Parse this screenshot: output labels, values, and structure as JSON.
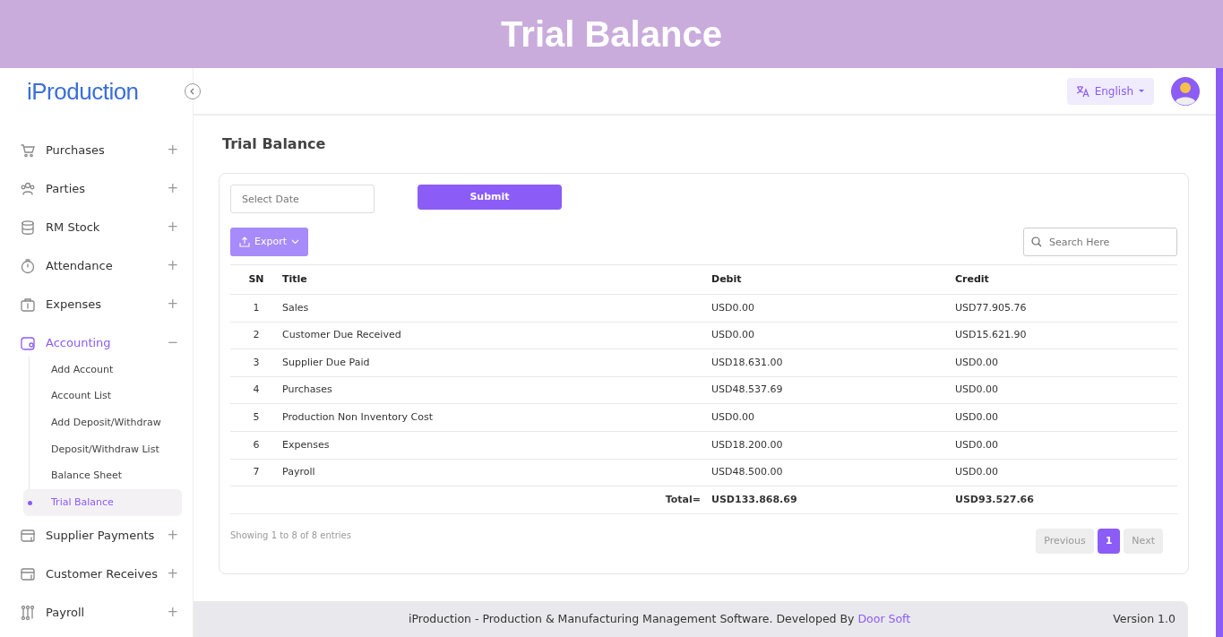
{
  "banner": {
    "title": "Trial Balance"
  },
  "sidebar": {
    "logo": "iProduction",
    "items": [
      {
        "label": "Purchases",
        "toggle": "+",
        "expanded": false
      },
      {
        "label": "Parties",
        "toggle": "+",
        "expanded": false
      },
      {
        "label": "RM Stock",
        "toggle": "+",
        "expanded": false
      },
      {
        "label": "Attendance",
        "toggle": "+",
        "expanded": false
      },
      {
        "label": "Expenses",
        "toggle": "+",
        "expanded": false
      },
      {
        "label": "Accounting",
        "toggle": "−",
        "expanded": true,
        "children": [
          {
            "label": "Add Account",
            "selected": false
          },
          {
            "label": "Account List",
            "selected": false
          },
          {
            "label": "Add Deposit/Withdraw",
            "selected": false
          },
          {
            "label": "Deposit/Withdraw List",
            "selected": false
          },
          {
            "label": "Balance Sheet",
            "selected": false
          },
          {
            "label": "Trial Balance",
            "selected": true
          }
        ]
      },
      {
        "label": "Supplier Payments",
        "toggle": "+",
        "expanded": false
      },
      {
        "label": "Customer Receives",
        "toggle": "+",
        "expanded": false
      },
      {
        "label": "Payroll",
        "toggle": "+",
        "expanded": false
      }
    ]
  },
  "topbar": {
    "language": "English"
  },
  "page_title": "Trial Balance",
  "filter": {
    "date_placeholder": "Select Date",
    "submit": "Submit"
  },
  "toolbar": {
    "export": "Export",
    "search_placeholder": "Search Here"
  },
  "table": {
    "columns": [
      "SN",
      "Title",
      "Debit",
      "Credit"
    ],
    "rows": [
      [
        "1",
        "Sales",
        "USD0.00",
        "USD77.905.76"
      ],
      [
        "2",
        "Customer Due Received",
        "USD0.00",
        "USD15.621.90"
      ],
      [
        "3",
        "Supplier Due Paid",
        "USD18.631.00",
        "USD0.00"
      ],
      [
        "4",
        "Purchases",
        "USD48.537.69",
        "USD0.00"
      ],
      [
        "5",
        "Production Non Inventory Cost",
        "USD0.00",
        "USD0.00"
      ],
      [
        "6",
        "Expenses",
        "USD18.200.00",
        "USD0.00"
      ],
      [
        "7",
        "Payroll",
        "USD48.500.00",
        "USD0.00"
      ]
    ],
    "total": {
      "label": "Total=",
      "debit": "USD133.868.69",
      "credit": "USD93.527.66"
    }
  },
  "info": "Showing 1 to 8 of 8 entries",
  "pagination": [
    {
      "label": "Previous",
      "selected": false
    },
    {
      "label": "1",
      "selected": true
    },
    {
      "label": "Next",
      "selected": false
    }
  ],
  "footer": {
    "text": "iProduction - Production & Manufacturing Management Software. Developed By",
    "link": "Door Soft",
    "version": "Version 1.0"
  }
}
